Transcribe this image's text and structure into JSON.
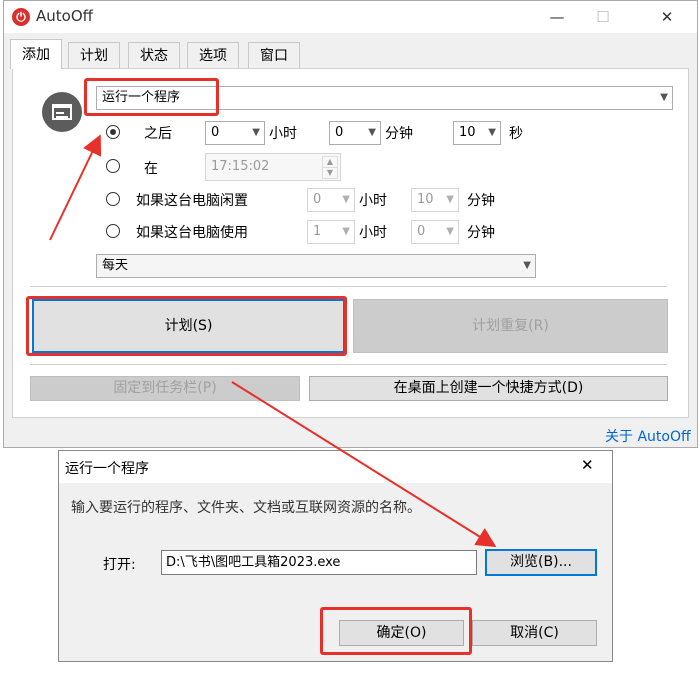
{
  "app": {
    "title": "AutoOff",
    "icon": "power-icon",
    "minimize": "—",
    "maximize": "☐",
    "close": "✕"
  },
  "tabs": [
    {
      "label": "添加",
      "active": true
    },
    {
      "label": "计划",
      "active": false
    },
    {
      "label": "状态",
      "active": false
    },
    {
      "label": "选项",
      "active": false
    },
    {
      "label": "窗口",
      "active": false
    }
  ],
  "form": {
    "action_select": "运行一个程序",
    "option_after": {
      "label": "之后",
      "hours": "0",
      "hours_unit": "小时",
      "minutes": "0",
      "minutes_unit": "分钟",
      "seconds": "10",
      "seconds_unit": "秒",
      "selected": true
    },
    "option_at": {
      "label": "在",
      "time": "17:15:02",
      "selected": false
    },
    "option_idle": {
      "label": "如果这台电脑闲置",
      "hours": "0",
      "hours_unit": "小时",
      "minutes": "10",
      "minutes_unit": "分钟",
      "selected": false
    },
    "option_used": {
      "label": "如果这台电脑使用",
      "hours": "1",
      "hours_unit": "小时",
      "minutes": "0",
      "minutes_unit": "分钟",
      "selected": false
    },
    "repeat_select": "每天"
  },
  "buttons": {
    "schedule": "计划(S)",
    "schedule_repeat": "计划重复(R)",
    "pin_taskbar": "固定到任务栏(P)",
    "desktop_shortcut": "在桌面上创建一个快捷方式(D)"
  },
  "about_link": "关于 AutoOff",
  "dialog": {
    "title": "运行一个程序",
    "close": "✕",
    "instruction": "输入要运行的程序、文件夹、文档或互联网资源的名称。",
    "open_label": "打开:",
    "open_value": "D:\\飞书\\图吧工具箱2023.exe",
    "browse": "浏览(B)...",
    "ok": "确定(O)",
    "cancel": "取消(C)"
  },
  "colors": {
    "annotation_red": "#e8302a",
    "link_blue": "#0066cc",
    "focus_blue": "#0078d7"
  }
}
